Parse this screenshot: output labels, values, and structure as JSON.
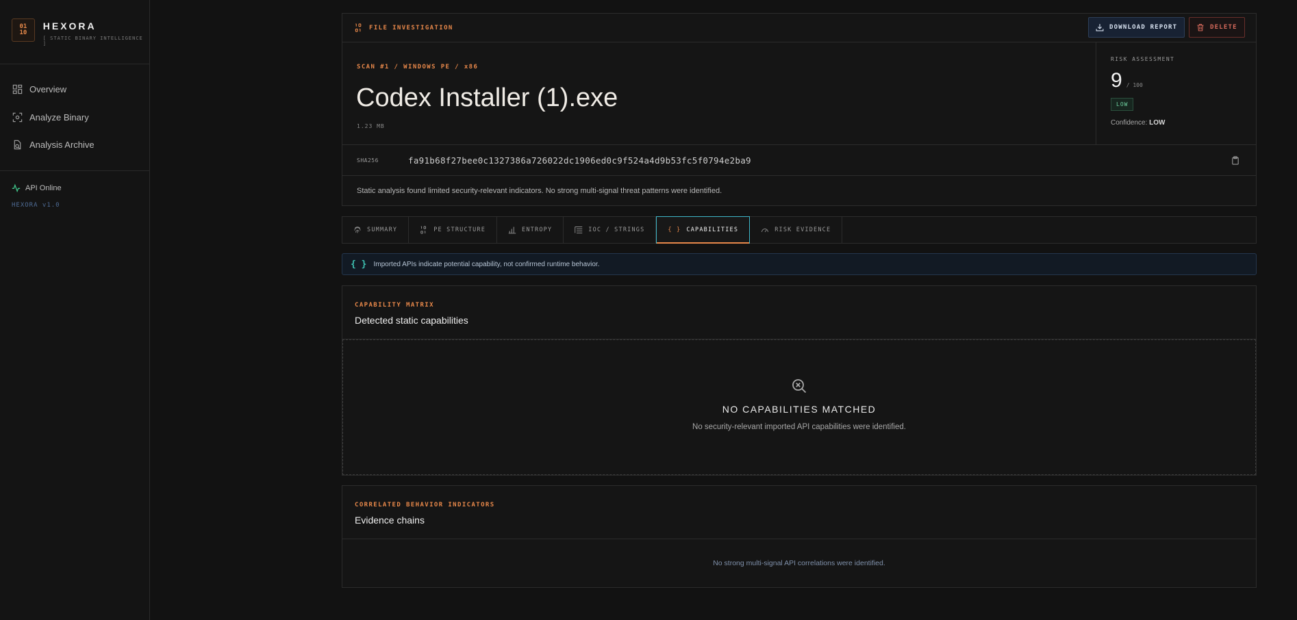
{
  "brand": {
    "logo_top": "01",
    "logo_bottom": "10",
    "name": "HEXORA",
    "tagline": "[ STATIC BINARY INTELLIGENCE ]"
  },
  "sidebar": {
    "items": [
      {
        "label": "Overview",
        "icon": "grid-icon"
      },
      {
        "label": "Analyze Binary",
        "icon": "scan-icon"
      },
      {
        "label": "Analysis Archive",
        "icon": "archive-icon"
      }
    ],
    "api_status": "API Online",
    "version": "HEXORA v1.0"
  },
  "header": {
    "section_label": "FILE INVESTIGATION",
    "download_label": "DOWNLOAD REPORT",
    "delete_label": "DELETE",
    "scan_label": "SCAN #1 / WINDOWS PE / x86",
    "file_name": "Codex Installer (1).exe",
    "file_size": "1.23 MB",
    "sha_label": "SHA256",
    "sha_value": "fa91b68f27bee0c1327386a726022dc1906ed0c9f524a4d9b53fc5f0794e2ba9",
    "summary": "Static analysis found limited security-relevant indicators. No strong multi-signal threat patterns were identified."
  },
  "risk": {
    "title": "RISK ASSESSMENT",
    "score": "9",
    "max": "/ 100",
    "level": "LOW",
    "confidence_label": "Confidence:",
    "confidence_value": "LOW"
  },
  "tabs": [
    {
      "label": "SUMMARY",
      "icon": "fingerprint-icon"
    },
    {
      "label": "PE STRUCTURE",
      "icon": "binary-icon"
    },
    {
      "label": "ENTROPY",
      "icon": "bar-chart-icon"
    },
    {
      "label": "IOC / STRINGS",
      "icon": "list-icon"
    },
    {
      "label": "CAPABILITIES",
      "icon": "braces-icon",
      "active": true
    },
    {
      "label": "RISK EVIDENCE",
      "icon": "gauge-icon"
    }
  ],
  "info_bar": {
    "icon": "{ }",
    "text": "Imported APIs indicate potential capability, not confirmed runtime behavior."
  },
  "capabilities": {
    "label": "CAPABILITY MATRIX",
    "title": "Detected static capabilities",
    "empty_title": "NO CAPABILITIES MATCHED",
    "empty_desc": "No security-relevant imported API capabilities were identified."
  },
  "correlations": {
    "label": "CORRELATED BEHAVIOR INDICATORS",
    "title": "Evidence chains",
    "empty_desc": "No strong multi-signal API correlations were identified."
  },
  "colors": {
    "accent": "#e8884a",
    "active_tab_border": "#3fb7c9",
    "success": "#6fd1a0",
    "danger": "#d66a5c"
  }
}
